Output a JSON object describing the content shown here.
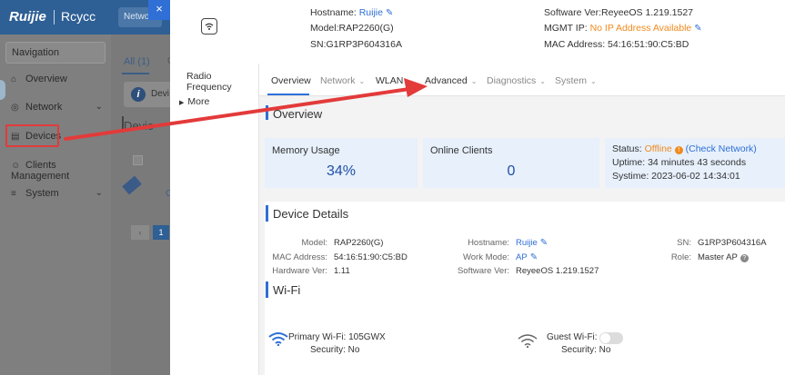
{
  "background": {
    "logo": "Ruijie",
    "brand": "Rcycc",
    "network_button": "Network",
    "nav_box": "Navigation",
    "nav": [
      {
        "label": "Overview",
        "icon": "home-icon"
      },
      {
        "label": "Network",
        "icon": "globe-icon"
      },
      {
        "label": "Devices",
        "icon": "devices-icon"
      },
      {
        "label": "Clients Management",
        "icon": "user-icon"
      },
      {
        "label": "System",
        "icon": "settings-icon"
      }
    ],
    "tab_all": "All (1)",
    "tab_c": "C",
    "info_text": "Devi",
    "title": "Devic",
    "c2": "C",
    "pager_prev": "‹",
    "pager_current": "1"
  },
  "drawer": {
    "close_icon": "×",
    "hostname_label": "Hostname:",
    "hostname_value": "Ruijie",
    "model_text": "Model:RAP2260(G)",
    "sn_text": "SN:G1RP3P604316A",
    "software_text": "Software Ver:ReyeeOS 1.219.1527",
    "mgmt_label": "MGMT IP:",
    "mgmt_value": "No IP Address Available",
    "mac_text": "MAC Address: 54:16:51:90:C5:BD",
    "left_items": [
      "Radio Frequency",
      "More"
    ],
    "tabs": [
      {
        "label": "Overview",
        "has_chevron": false
      },
      {
        "label": "Network",
        "has_chevron": true
      },
      {
        "label": "WLAN",
        "has_chevron": true
      },
      {
        "label": "Advanced",
        "has_chevron": true
      },
      {
        "label": "Diagnostics",
        "has_chevron": true
      },
      {
        "label": "System",
        "has_chevron": true
      }
    ],
    "overview_title": "Overview",
    "memory_label": "Memory Usage",
    "memory_value": "34%",
    "clients_label": "Online Clients",
    "clients_value": "0",
    "status_label": "Status:",
    "status_value": "Offline",
    "check_network": "(Check Network)",
    "uptime": "Uptime: 34 minutes 43 seconds",
    "systime": "Systime: 2023-06-02 14:34:01",
    "details_title": "Device Details",
    "details": {
      "model_label": "Model:",
      "model_value": "RAP2260(G)",
      "mac_label": "MAC Address:",
      "mac_value": "54:16:51:90:C5:BD",
      "hw_label": "Hardware Ver:",
      "hw_value": "1.11",
      "hostname_label": "Hostname:",
      "hostname_value": "Ruijie",
      "workmode_label": "Work Mode:",
      "workmode_value": "AP",
      "sw_label": "Software Ver:",
      "sw_value": "ReyeeOS 1.219.1527",
      "sn_label": "SN:",
      "sn_value": "G1RP3P604316A",
      "role_label": "Role:",
      "role_value": "Master AP"
    },
    "wifi_title": "Wi-Fi",
    "primary_wifi_label": "Primary Wi-Fi:",
    "primary_wifi_value": "105GWX",
    "primary_security": "Security: No",
    "guest_wifi_label": "Guest Wi-Fi:",
    "guest_security": "Security: No"
  },
  "colors": {
    "accent": "#2f6fd6",
    "warning": "#f08a1c",
    "annotation_red": "#e33a3a"
  }
}
